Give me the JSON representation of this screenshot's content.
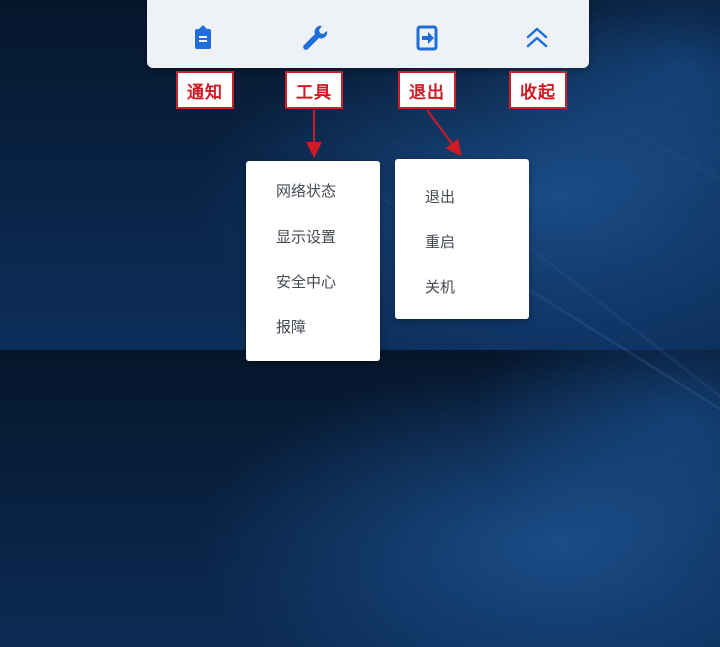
{
  "toolbar": {
    "buttons": [
      {
        "id": "notify",
        "icon": "notification-bag-icon",
        "label": "通知"
      },
      {
        "id": "tools",
        "icon": "wrench-icon",
        "label": "工具"
      },
      {
        "id": "exit",
        "icon": "exit-door-icon",
        "label": "退出"
      },
      {
        "id": "collapse",
        "icon": "double-chevron-up-icon",
        "label": "收起"
      }
    ]
  },
  "tools_menu": {
    "items": [
      "网络状态",
      "显示设置",
      "安全中心",
      "报障"
    ]
  },
  "exit_menu": {
    "items": [
      "退出",
      "重启",
      "关机"
    ]
  },
  "colors": {
    "icon_blue": "#1f6fd8",
    "annotation_red": "#cc1e28",
    "toolbar_bg": "#eef1f5"
  }
}
